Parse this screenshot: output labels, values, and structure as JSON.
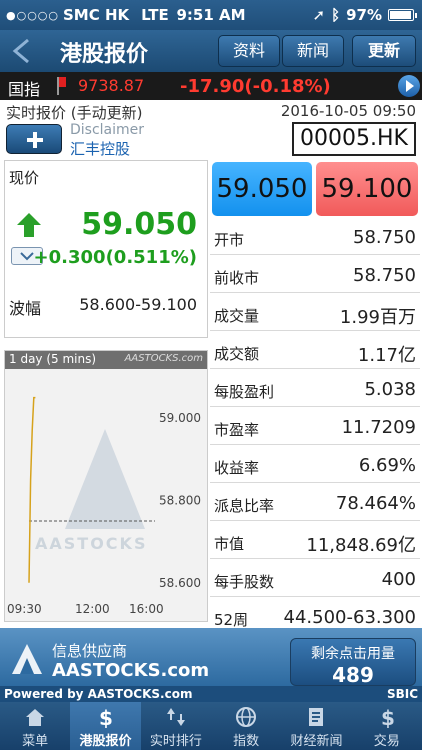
{
  "status_bar": {
    "carrier": "SMC HK",
    "network": "LTE",
    "time": "9:51 AM",
    "battery": "97%",
    "battery_level": 0.97
  },
  "nav": {
    "title": "港股报价",
    "data_label": "资料",
    "news_label": "新闻",
    "update_label": "更新"
  },
  "index_ticker": {
    "label": "国指",
    "value": "9738.87",
    "change": "-17.90(-0.18%)"
  },
  "info": {
    "mode": "实时报价 (手动更新)",
    "timestamp": "2016-10-05 09:50",
    "disclaimer": "Disclaimer",
    "stock_name": "汇丰控股",
    "stock_code": "00005.HK"
  },
  "price_card": {
    "now_label": "现价",
    "price": "59.050",
    "change": "+0.300(0.511%)",
    "range_label": "波幅",
    "range": "58.600-59.100"
  },
  "bid_ask": {
    "bid": "59.050",
    "ask": "59.100"
  },
  "stats": [
    {
      "label": "开市",
      "value": "58.750"
    },
    {
      "label": "前收市",
      "value": "58.750"
    },
    {
      "label": "成交量",
      "value": "1.99百万"
    },
    {
      "label": "成交额",
      "value": "1.17亿"
    },
    {
      "label": "每股盈利",
      "value": "5.038"
    },
    {
      "label": "市盈率",
      "value": "11.7209"
    },
    {
      "label": "收益率",
      "value": "6.69%"
    },
    {
      "label": "派息比率",
      "value": "78.464%"
    },
    {
      "label": "市值",
      "value": "11,848.69亿"
    },
    {
      "label": "每手股数",
      "value": "400"
    },
    {
      "label": "52周",
      "value": "44.500-63.300"
    }
  ],
  "chart": {
    "header": "1 day (5 mins)",
    "brand": "AASTOCKS.com",
    "watermark": "AASTOCKS"
  },
  "chart_data": {
    "type": "line",
    "title": "1 day (5 mins)",
    "xlabel": "",
    "ylabel": "",
    "x_ticks": [
      "09:30",
      "12:00",
      "16:00"
    ],
    "y_ticks": [
      58.6,
      58.8,
      59.0
    ],
    "ylim": [
      58.58,
      59.1
    ],
    "previous_close": 58.75,
    "series": [
      {
        "x": [
          0,
          1,
          2,
          3,
          4
        ],
        "values": [
          58.6,
          58.85,
          58.97,
          59.05,
          59.05
        ]
      }
    ]
  },
  "provider": {
    "label": "信息供应商",
    "name": "AASTOCKS.com",
    "usage_label": "剩余点击用量",
    "usage_value": "489",
    "powered_by": "Powered by AASTOCKS.com",
    "sbic": "SBIC"
  },
  "tabs": [
    {
      "label": "菜单",
      "icon": "home-icon"
    },
    {
      "label": "港股报价",
      "icon": "dollar-icon"
    },
    {
      "label": "实时排行",
      "icon": "sort-icon"
    },
    {
      "label": "指数",
      "icon": "globe-icon"
    },
    {
      "label": "财经新闻",
      "icon": "news-icon"
    },
    {
      "label": "交易",
      "icon": "trade-icon"
    }
  ],
  "colors": {
    "up": "#1e9e1e",
    "down": "#ff3b30",
    "bid_bg": "#1391ee",
    "ask_bg": "#f15a5a"
  }
}
